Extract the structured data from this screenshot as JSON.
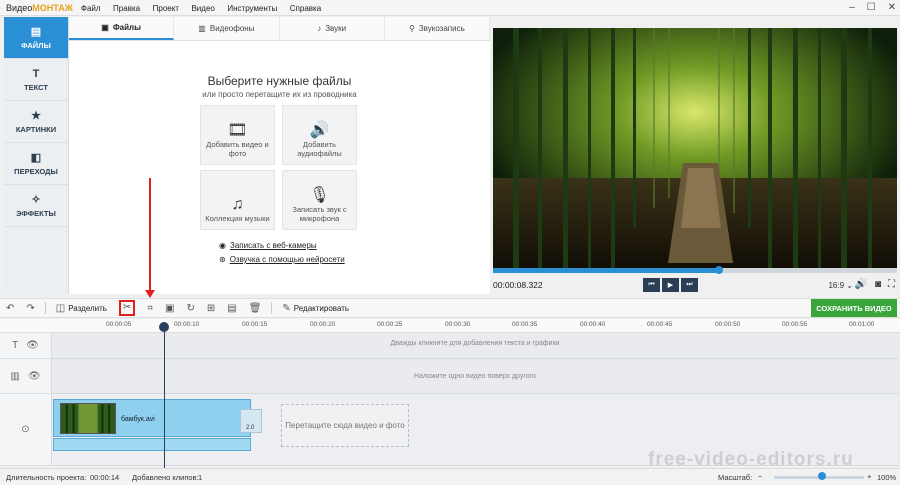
{
  "app": {
    "brand_prefix": "Видео",
    "brand_suffix": "МОНТАЖ",
    "menu": [
      "Файл",
      "Правка",
      "Проект",
      "Видео",
      "Инструменты",
      "Справка"
    ]
  },
  "sidebar": {
    "items": [
      {
        "label": "ФАЙЛЫ",
        "icon": "folder-icon"
      },
      {
        "label": "ТЕКСТ",
        "icon": "text-icon"
      },
      {
        "label": "КАРТИНКИ",
        "icon": "star-icon"
      },
      {
        "label": "ПЕРЕХОДЫ",
        "icon": "transitions-icon"
      },
      {
        "label": "ЭФФЕКТЫ",
        "icon": "wand-icon"
      }
    ]
  },
  "library": {
    "tabs": [
      "Файлы",
      "Видеофоны",
      "Звуки",
      "Звукозапись"
    ],
    "title": "Выберите нужные файлы",
    "subtitle": "или просто перетащите их из проводника",
    "tiles": [
      "Добавить видео и фото",
      "Добавить аудиофайлы",
      "Коллекция музыки",
      "Записать звук с микрофона"
    ],
    "links": [
      "Записать с веб-камеры",
      "Озвучка с помощью нейросети"
    ]
  },
  "preview": {
    "timecode": "00:00:08.322",
    "aspect": "16:9",
    "progress": 0.56
  },
  "toolbar": {
    "split_label": "Разделить",
    "edit_label": "Редактировать",
    "save_label": "СОХРАНИТЬ ВИДЕО"
  },
  "timeline": {
    "ruler": [
      "00:00:05",
      "00:00:10",
      "00:00:15",
      "00:00:20",
      "00:00:25",
      "00:00:30",
      "00:00:35",
      "00:00:40",
      "00:00:45",
      "00:00:50",
      "00:00:55",
      "00:01:00"
    ],
    "text_hint": "Дважды кликните для добавления текста и графики",
    "overlay_hint": "Наложите одно видео поверх другого",
    "clip_name": "бамбук.avi",
    "trans_label": "2.0",
    "drop_hint": "Перетащите сюда видео и фото"
  },
  "status": {
    "duration_label": "Длительность проекта:",
    "duration": "00:00:14",
    "clips_label": "Добавлено клипов:",
    "clips": "1",
    "zoom_label": "Масштаб:",
    "zoom_pct": "100%",
    "zoom_value": 0.5
  },
  "watermark": "free-video-editors.ru",
  "colors": {
    "accent": "#2b8fd6",
    "save": "#3aa53a",
    "highlight": "#e02020"
  }
}
